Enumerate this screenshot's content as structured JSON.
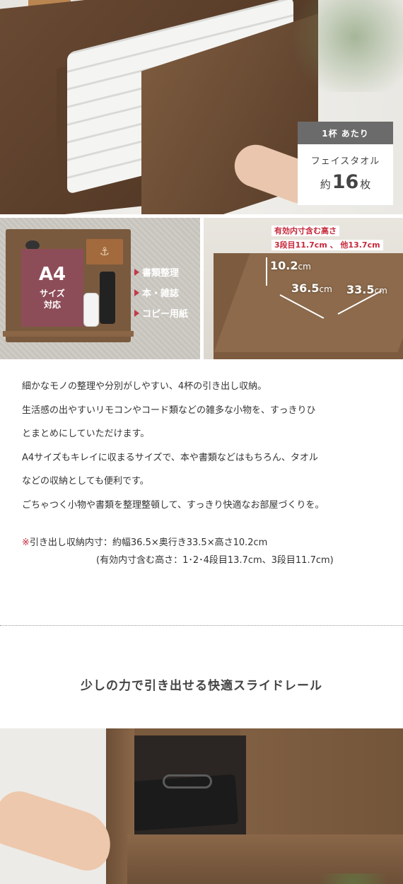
{
  "hero": {
    "badge_header": "1杯 あたり",
    "badge_item": "フェイスタオル",
    "badge_prefix": "約",
    "badge_number": "16",
    "badge_suffix": "枚"
  },
  "left_panel": {
    "a4_big": "A4",
    "a4_line1": "サイズ",
    "a4_line2": "対応",
    "features": [
      "書類整理",
      "本・雑誌",
      "コピー用紙"
    ],
    "accent_color": "#c13a4a"
  },
  "right_panel": {
    "note_line1": "有効内寸含む高さ",
    "note_line2": "3段目11.7cm 、 他13.7cm",
    "height_value": "10.2",
    "width_value": "36.5",
    "depth_value": "33.5",
    "unit": "cm"
  },
  "description": {
    "lines": [
      "細かなモノの整理や分別がしやすい、4杯の引き出し収納。",
      "生活感の出やすいリモコンやコード類などの雑多な小物を、すっきりひ",
      "とまとめにしていただけます。",
      "A4サイズもキレイに収まるサイズで、本や書類などはもちろん、タオル",
      "などの収納としても便利です。",
      "ごちゃつく小物や書類を整理整頓して、すっきり快適なお部屋づくりを。"
    ],
    "note_mark": "※",
    "note_line1": "引き出し収納内寸：約幅36.5×奥行き33.5×高さ10.2cm",
    "note_line2": "(有効内寸含む高さ：1･2･4段目13.7cm、3段目11.7cm)"
  },
  "section2": {
    "title": "少しの力で引き出せる快適スライドレール"
  }
}
